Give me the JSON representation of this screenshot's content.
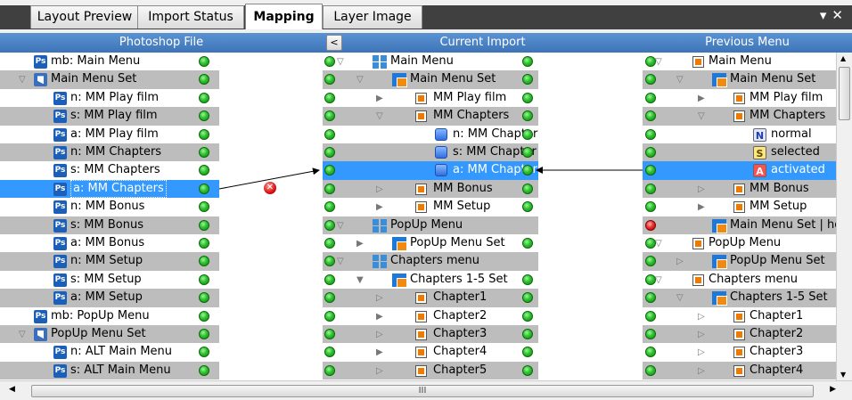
{
  "tabs": [
    {
      "label": "Layout Preview",
      "active": false
    },
    {
      "label": "Import Status",
      "active": false
    },
    {
      "label": "Mapping",
      "active": true
    },
    {
      "label": "Layer Image",
      "active": false
    }
  ],
  "window_controls": {
    "pin": "▾",
    "close": "✕"
  },
  "columns": {
    "photoshop": "Photoshop File",
    "current": "Current Import",
    "previous": "Previous Menu",
    "collapse_button": "<"
  },
  "photoshop_rows": [
    {
      "indent": 0,
      "icon": "ps-icon",
      "label": "mb: Main Menu",
      "status": "green"
    },
    {
      "indent": 0,
      "icon": "folder-icon",
      "expander": "▽",
      "label": "Main Menu Set",
      "status": "green"
    },
    {
      "indent": 1,
      "icon": "ps-icon",
      "label": "n: MM Play film",
      "status": "green"
    },
    {
      "indent": 1,
      "icon": "ps-icon",
      "label": "s: MM Play film",
      "status": "green"
    },
    {
      "indent": 1,
      "icon": "ps-icon",
      "label": "a: MM Play film",
      "status": "green"
    },
    {
      "indent": 1,
      "icon": "ps-icon",
      "label": "n: MM Chapters",
      "status": "green"
    },
    {
      "indent": 1,
      "icon": "ps-icon",
      "label": "s: MM Chapters",
      "status": "green"
    },
    {
      "indent": 1,
      "icon": "ps-icon",
      "label": "a: MM Chapters",
      "status": "green",
      "selected": true
    },
    {
      "indent": 1,
      "icon": "ps-icon",
      "label": "n: MM Bonus",
      "status": "green"
    },
    {
      "indent": 1,
      "icon": "ps-icon",
      "label": "s: MM Bonus",
      "status": "green"
    },
    {
      "indent": 1,
      "icon": "ps-icon",
      "label": "a: MM Bonus",
      "status": "green"
    },
    {
      "indent": 1,
      "icon": "ps-icon",
      "label": "n: MM Setup",
      "status": "green"
    },
    {
      "indent": 1,
      "icon": "ps-icon",
      "label": "s: MM Setup",
      "status": "green"
    },
    {
      "indent": 1,
      "icon": "ps-icon",
      "label": "a: MM Setup",
      "status": "green"
    },
    {
      "indent": 0,
      "icon": "ps-icon",
      "label": "mb: PopUp Menu",
      "status": "green"
    },
    {
      "indent": 0,
      "icon": "folder-icon",
      "expander": "▽",
      "label": "PopUp Menu Set",
      "status": "green"
    },
    {
      "indent": 1,
      "icon": "ps-icon",
      "label": "n: ALT Main Menu",
      "status": "green"
    },
    {
      "indent": 1,
      "icon": "ps-icon",
      "label": "s: ALT Main Menu",
      "status": "green"
    }
  ],
  "current_rows": [
    {
      "expander": "▽",
      "exp_col": 0,
      "icon": "menu-icon",
      "label": "Main Menu",
      "status": "green",
      "lead_dot": true
    },
    {
      "expander": "▽",
      "exp_col": 1,
      "icon": "menuset-icon",
      "label": "Main Menu Set",
      "status": "green",
      "lead_dot": true
    },
    {
      "expander": "▶",
      "exp_col": 2,
      "icon": "button-icon",
      "label": "MM Play film",
      "status": "green",
      "lead_dot": true
    },
    {
      "expander": "▽",
      "exp_col": 2,
      "icon": "button-icon",
      "label": "MM Chapters",
      "status": "green",
      "lead_dot": true
    },
    {
      "expander": "",
      "exp_col": 3,
      "icon": "state-icon",
      "label": "n: MM Chapter",
      "status": "green",
      "lead_dot": true
    },
    {
      "expander": "",
      "exp_col": 3,
      "icon": "state-icon",
      "label": "s: MM Chapter",
      "status": "green",
      "lead_dot": true
    },
    {
      "expander": "",
      "exp_col": 3,
      "icon": "state-icon",
      "label": "a: MM Chapter",
      "status": "green",
      "lead_dot": true,
      "selected": true
    },
    {
      "expander": "▷",
      "exp_col": 2,
      "icon": "button-icon",
      "label": "MM Bonus",
      "status": "green",
      "lead_dot": true
    },
    {
      "expander": "▶",
      "exp_col": 2,
      "icon": "button-icon",
      "label": "MM Setup",
      "status": "green",
      "lead_dot": true
    },
    {
      "expander": "▽",
      "exp_col": 0,
      "icon": "menu-icon",
      "label": "PopUp Menu",
      "status": "",
      "lead_dot": true
    },
    {
      "expander": "▶",
      "exp_col": 1,
      "icon": "menuset-icon",
      "label": "PopUp Menu Set",
      "status": "green",
      "lead_dot": true
    },
    {
      "expander": "▽",
      "exp_col": 0,
      "icon": "menu-icon",
      "label": "Chapters menu",
      "status": "",
      "lead_dot": true
    },
    {
      "expander": "▼",
      "exp_col": 1,
      "icon": "menuset-icon",
      "label": "Chapters 1-5 Set",
      "status": "green",
      "lead_dot": true
    },
    {
      "expander": "▷",
      "exp_col": 2,
      "icon": "button-icon",
      "label": "Chapter1",
      "status": "green",
      "lead_dot": true
    },
    {
      "expander": "▶",
      "exp_col": 2,
      "icon": "button-icon",
      "label": "Chapter2",
      "status": "green",
      "lead_dot": true
    },
    {
      "expander": "▷",
      "exp_col": 2,
      "icon": "button-icon",
      "label": "Chapter3",
      "status": "green",
      "lead_dot": true
    },
    {
      "expander": "▶",
      "exp_col": 2,
      "icon": "button-icon",
      "label": "Chapter4",
      "status": "green",
      "lead_dot": true
    },
    {
      "expander": "▷",
      "exp_col": 2,
      "icon": "button-icon",
      "label": "Chapter5",
      "status": "green",
      "lead_dot": true
    }
  ],
  "previous_rows": [
    {
      "expander": "▽",
      "exp_col": 0,
      "icon": "button-icon",
      "label": "Main Menu",
      "lead": "green"
    },
    {
      "expander": "▽",
      "exp_col": 1,
      "icon": "menuset-icon",
      "label": "Main Menu Set",
      "lead": "green"
    },
    {
      "expander": "▶",
      "exp_col": 2,
      "icon": "button-icon",
      "label": "MM Play film",
      "lead": "green"
    },
    {
      "expander": "▽",
      "exp_col": 2,
      "icon": "button-icon",
      "label": "MM Chapters",
      "lead": "green"
    },
    {
      "expander": "",
      "exp_col": 3,
      "icon": "letter-n",
      "letter": "N",
      "label": "normal",
      "lead": "green"
    },
    {
      "expander": "",
      "exp_col": 3,
      "icon": "letter-s",
      "letter": "S",
      "label": "selected",
      "lead": "green"
    },
    {
      "expander": "",
      "exp_col": 3,
      "icon": "letter-a",
      "letter": "A",
      "label": "activated",
      "lead": "green",
      "selected": true
    },
    {
      "expander": "▷",
      "exp_col": 2,
      "icon": "button-icon",
      "label": "MM Bonus",
      "lead": "green"
    },
    {
      "expander": "▶",
      "exp_col": 2,
      "icon": "button-icon",
      "label": "MM Setup",
      "lead": "green"
    },
    {
      "expander": "",
      "exp_col": 1,
      "icon": "menuset-icon",
      "label": "Main Menu Set | ho",
      "lead": "red"
    },
    {
      "expander": "▽",
      "exp_col": 0,
      "icon": "button-icon",
      "label": "PopUp Menu",
      "lead": "green"
    },
    {
      "expander": "▷",
      "exp_col": 1,
      "icon": "menuset-icon",
      "label": "PopUp Menu Set",
      "lead": "green"
    },
    {
      "expander": "▽",
      "exp_col": 0,
      "icon": "button-icon",
      "label": "Chapters menu",
      "lead": "green"
    },
    {
      "expander": "▽",
      "exp_col": 1,
      "icon": "menuset-icon",
      "label": "Chapters 1-5 Set",
      "lead": "green"
    },
    {
      "expander": "▷",
      "exp_col": 2,
      "icon": "button-icon",
      "label": "Chapter1",
      "lead": "green"
    },
    {
      "expander": "▷",
      "exp_col": 2,
      "icon": "button-icon",
      "label": "Chapter2",
      "lead": "green"
    },
    {
      "expander": "▷",
      "exp_col": 2,
      "icon": "button-icon",
      "label": "Chapter3",
      "lead": "green"
    },
    {
      "expander": "▷",
      "exp_col": 2,
      "icon": "button-icon",
      "label": "Chapter4",
      "lead": "green"
    }
  ],
  "colors": {
    "header": "#4a85c8",
    "selection": "#3399ff",
    "row_alt": "#bdbdbd",
    "status_ok": "#2fc02f",
    "status_error": "#e83030"
  },
  "hscroll_grip": "III"
}
